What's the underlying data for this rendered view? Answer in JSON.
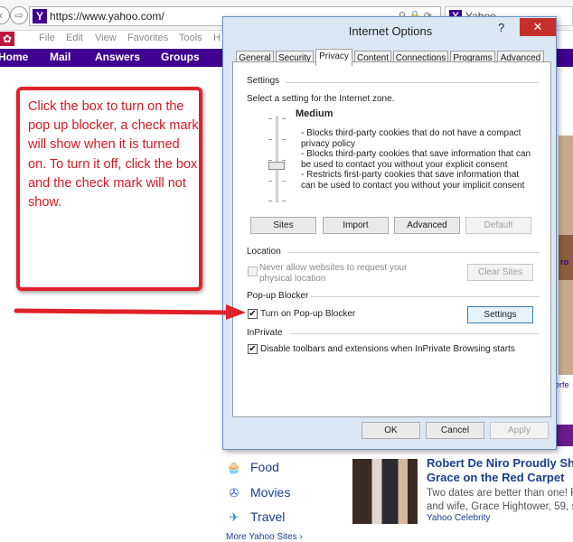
{
  "browser": {
    "address": "https://www.yahoo.com/",
    "tab_title": "Yahoo",
    "menu": [
      "File",
      "Edit",
      "View",
      "Favorites",
      "Tools",
      "H"
    ],
    "yahoo_nav": [
      "Home",
      "Mail",
      "Answers",
      "Groups"
    ]
  },
  "callout": {
    "text": "Click the box to turn on the pop up blocker, a check mark will show when it is turned on. To turn it off, click the box and the check mark will not show.",
    "color": "#e0202a"
  },
  "dialog": {
    "title": "Internet Options",
    "help_label": "?",
    "close_label": "✕",
    "tabs": [
      "General",
      "Security",
      "Privacy",
      "Content",
      "Connections",
      "Programs",
      "Advanced"
    ],
    "active_tab": "Privacy",
    "settings": {
      "group_label": "Settings",
      "prompt": "Select a setting for the Internet zone.",
      "level": "Medium",
      "bullets": [
        "- Blocks third-party cookies that do not have a compact privacy policy",
        "- Blocks third-party cookies that save information that can be used to contact you without your explicit consent",
        "- Restricts first-party cookies that save information that can be used to contact you without your implicit consent"
      ],
      "buttons": {
        "sites": "Sites",
        "import": "Import",
        "advanced": "Advanced",
        "default": "Default"
      }
    },
    "location": {
      "group_label": "Location",
      "checkbox_label": "Never allow websites to request your physical location",
      "checked": false,
      "clear_button": "Clear Sites"
    },
    "popup": {
      "group_label": "Pop-up Blocker",
      "checkbox_label": "Turn on Pop-up Blocker",
      "checked": true,
      "settings_button": "Settings"
    },
    "inprivate": {
      "group_label": "InPrivate",
      "checkbox_label": "Disable toolbars and extensions when InPrivate Browsing starts",
      "checked": true
    },
    "footer": {
      "ok": "OK",
      "cancel": "Cancel",
      "apply": "Apply"
    },
    "check_glyph": "✔"
  },
  "page": {
    "categories": [
      {
        "label": "Food",
        "icon": "food-icon"
      },
      {
        "label": "Movies",
        "icon": "movies-icon"
      },
      {
        "label": "Travel",
        "icon": "travel-icon"
      }
    ],
    "more_link": "More Yahoo Sites ›",
    "news": {
      "title_line1": "Robert De Niro Proudly Sh",
      "title_line2": "Grace on the Red Carpet",
      "body_line1": "Two dates are better than one! R",
      "body_line2": "and wife, Grace Hightower, 59, s",
      "source": "Yahoo Celebrity"
    },
    "side_fragments": [
      "ro",
      "erfe"
    ]
  }
}
